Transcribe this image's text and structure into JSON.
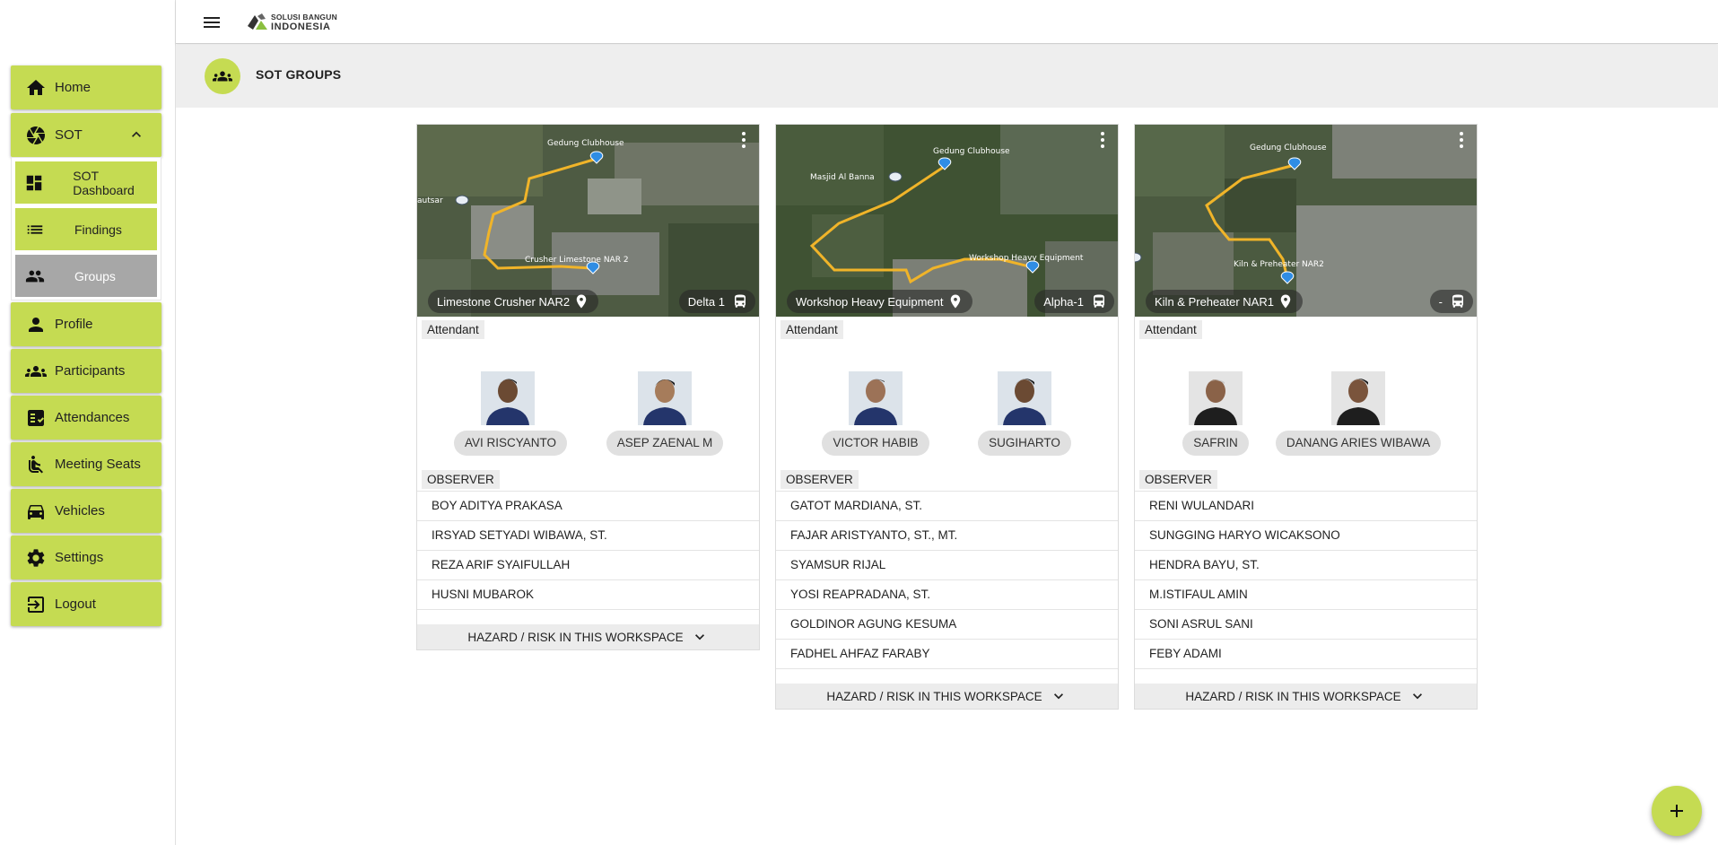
{
  "app": {
    "logo_line1": "SOLUSI BANGUN",
    "logo_line2": "INDONESIA"
  },
  "header": {
    "title": "SOT GROUPS"
  },
  "sidebar": {
    "items": [
      {
        "label": "Home",
        "icon": "home-icon"
      },
      {
        "label": "SOT",
        "icon": "aperture-icon",
        "expanded": true
      },
      {
        "label": "Profile",
        "icon": "person-icon"
      },
      {
        "label": "Participants",
        "icon": "groups-icon"
      },
      {
        "label": "Attendances",
        "icon": "checklist-icon"
      },
      {
        "label": "Meeting Seats",
        "icon": "seat-icon"
      },
      {
        "label": "Vehicles",
        "icon": "car-icon"
      },
      {
        "label": "Settings",
        "icon": "gear-icon"
      },
      {
        "label": "Logout",
        "icon": "logout-icon"
      }
    ],
    "sot_sub": [
      {
        "label": "SOT Dashboard",
        "icon": "dashboard-icon"
      },
      {
        "label": "Findings",
        "icon": "list-icon"
      },
      {
        "label": "Groups",
        "icon": "people-icon",
        "active": true
      }
    ]
  },
  "labels": {
    "attendant": "Attendant",
    "observer": "OBSERVER",
    "hazard": "HAZARD / RISK IN THIS WORKSPACE"
  },
  "groups": [
    {
      "map_labels": [
        "Gedung Clubhouse",
        "Crusher Limestone NAR 2",
        "autsar"
      ],
      "location": "Limestone Crusher NAR2",
      "vehicle": "Delta 1",
      "attendants": [
        "AVI RISCYANTO",
        "ASEP ZAENAL M"
      ],
      "observers": [
        "BOY ADITYA PRAKASA",
        "IRSYAD SETYADI WIBAWA, ST.",
        "REZA ARIF SYAIFULLAH",
        "HUSNI MUBAROK"
      ]
    },
    {
      "map_labels": [
        "Gedung Clubhouse",
        "Masjid Al Banna",
        "Workshop Heavy Equipment"
      ],
      "location": "Workshop Heavy Equipment",
      "vehicle": "Alpha-1",
      "attendants": [
        "VICTOR HABIB",
        "SUGIHARTO"
      ],
      "observers": [
        "GATOT MARDIANA, ST.",
        "FAJAR ARISTYANTO, ST., MT.",
        "SYAMSUR RIJAL",
        "YOSI REAPRADANA, ST.",
        "GOLDINOR AGUNG KESUMA",
        "FADHEL AHFAZ FARABY"
      ]
    },
    {
      "map_labels": [
        "Gedung Clubhouse",
        "Kiln & Preheater NAR2"
      ],
      "location": "Kiln & Preheater NAR1",
      "vehicle": "-",
      "attendants": [
        "SAFRIN",
        "DANANG ARIES WIBAWA"
      ],
      "observers": [
        "RENI WULANDARI",
        "SUNGGING HARYO WICAKSONO",
        "HENDRA BAYU, ST.",
        "M.ISTIFAUL AMIN",
        "SONI ASRUL SANI",
        "FEBY ADAMI"
      ]
    }
  ],
  "colors": {
    "accent": "#c5db52",
    "active": "#a7a7a7",
    "header_bg": "#eeeeee"
  }
}
